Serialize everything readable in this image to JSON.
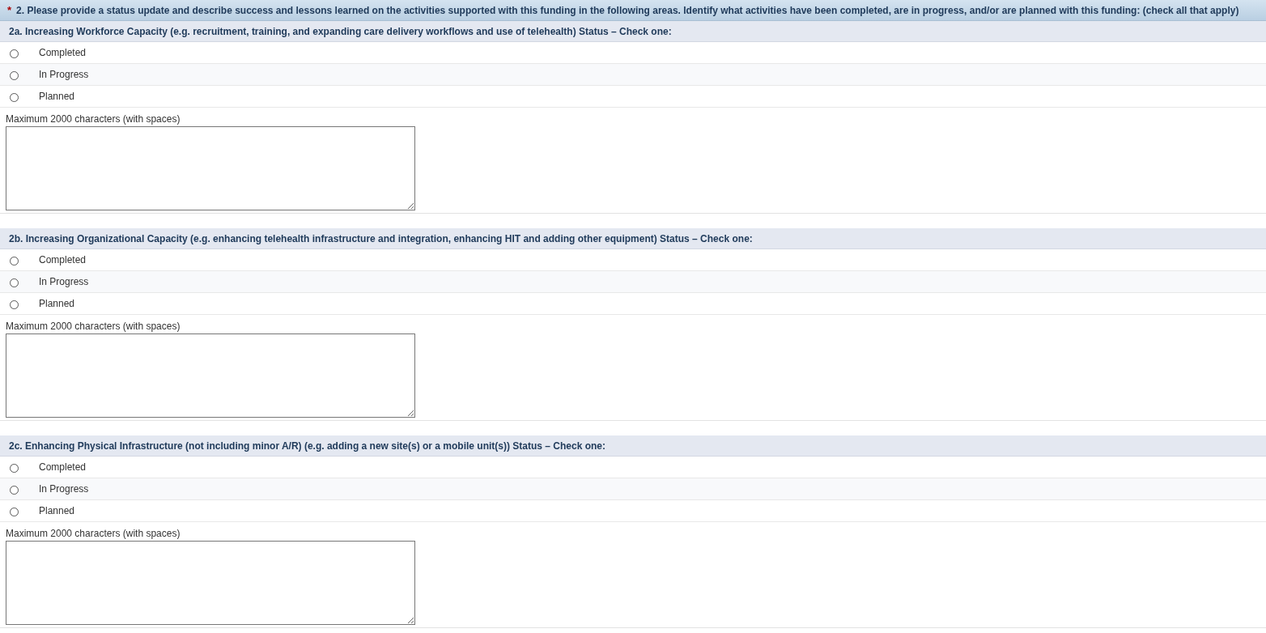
{
  "question": {
    "required_mark": "*",
    "text": "2. Please provide a status update and describe success and lessons learned on the activities supported with this funding in the following areas. Identify what activities have been completed, are in progress, and/or are planned with this funding: (check all that apply)"
  },
  "sections": [
    {
      "heading": "2a. Increasing Workforce Capacity (e.g. recruitment, training, and expanding care delivery workflows and use of telehealth) Status – Check one:",
      "options": [
        {
          "label": "Completed",
          "selected": false
        },
        {
          "label": "In Progress",
          "selected": false
        },
        {
          "label": "Planned",
          "selected": false
        }
      ],
      "limit_note": "Maximum 2000 characters (with spaces)"
    },
    {
      "heading": "2b. Increasing Organizational Capacity (e.g. enhancing telehealth infrastructure and integration, enhancing HIT and adding other equipment) Status – Check one:",
      "options": [
        {
          "label": "Completed",
          "selected": false
        },
        {
          "label": "In Progress",
          "selected": false
        },
        {
          "label": "Planned",
          "selected": false
        }
      ],
      "limit_note": "Maximum 2000 characters (with spaces)"
    },
    {
      "heading": "2c. Enhancing Physical Infrastructure (not including minor A/R) (e.g. adding a new site(s) or a mobile unit(s)) Status – Check one:",
      "options": [
        {
          "label": "Completed",
          "selected": false
        },
        {
          "label": "In Progress",
          "selected": false
        },
        {
          "label": "Planned",
          "selected": false
        }
      ],
      "limit_note": "Maximum 2000 characters (with spaces)"
    }
  ]
}
